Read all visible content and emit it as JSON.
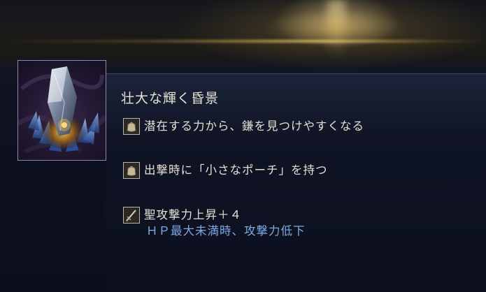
{
  "item": {
    "name": "壮大な輝く昏景",
    "image_icon": "crystal-shard-icon"
  },
  "effects": [
    {
      "icon": "pouch-icon",
      "text": "潜在する力から、鎌を見つけやすくなる"
    },
    {
      "icon": "pouch-icon",
      "text": "出撃時に「小さなポーチ」を持つ"
    },
    {
      "icon": "sword-icon",
      "text": "聖攻撃力上昇＋４",
      "condition": "ＨＰ最大未満時、攻撃力低下"
    }
  ],
  "colors": {
    "title_text": "#e6e2d6",
    "effect_text": "#e4e0d4",
    "condition_text": "#7fa9e6",
    "accent_glow": "#e6c46e"
  }
}
